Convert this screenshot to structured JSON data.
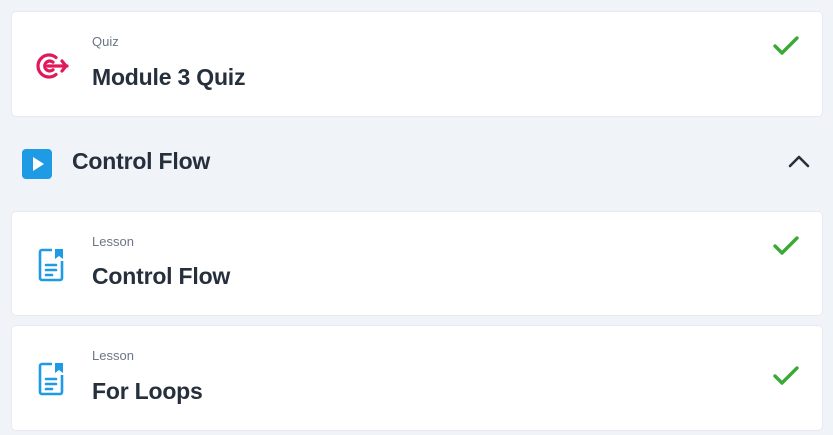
{
  "items_top": {
    "type_label": "Quiz",
    "title": "Module 3 Quiz",
    "icon": "target-icon",
    "completed": true
  },
  "section": {
    "title": "Control Flow",
    "icon": "play-icon",
    "expanded": true
  },
  "lessons": [
    {
      "type_label": "Lesson",
      "title": "Control Flow",
      "icon": "document-icon",
      "completed": true
    },
    {
      "type_label": "Lesson",
      "title": "For Loops",
      "icon": "document-icon",
      "completed": true
    }
  ],
  "colors": {
    "accent_quiz": "#e0195a",
    "accent_blue": "#1f9be6",
    "check_green": "#3aa935",
    "background": "#f0f3f7"
  }
}
